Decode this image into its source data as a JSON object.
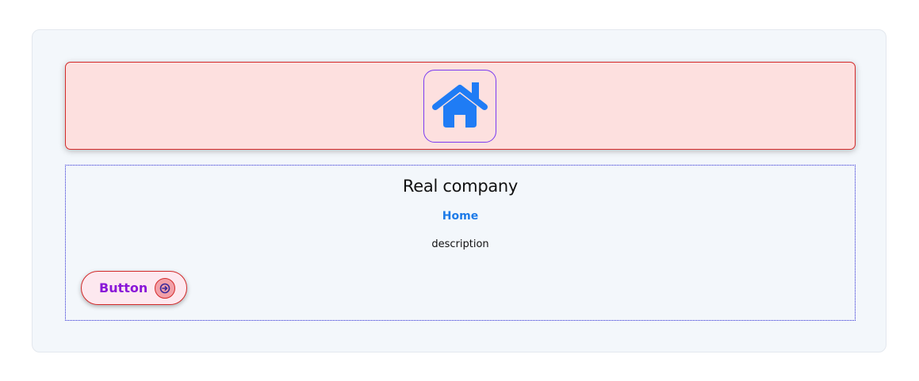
{
  "banner": {
    "icon": "home-icon",
    "background_color": "#fde0df",
    "border_color": "#d42a2a",
    "icon_color": "#1f7cf5",
    "icon_frame_color": "#7a3bf0"
  },
  "content": {
    "title": "Real company",
    "subtitle": "Home",
    "description": "description",
    "subtitle_color": "#1e7be8"
  },
  "button": {
    "label": "Button",
    "icon": "arrow-circle-right-icon",
    "label_color": "#8a17d8"
  }
}
